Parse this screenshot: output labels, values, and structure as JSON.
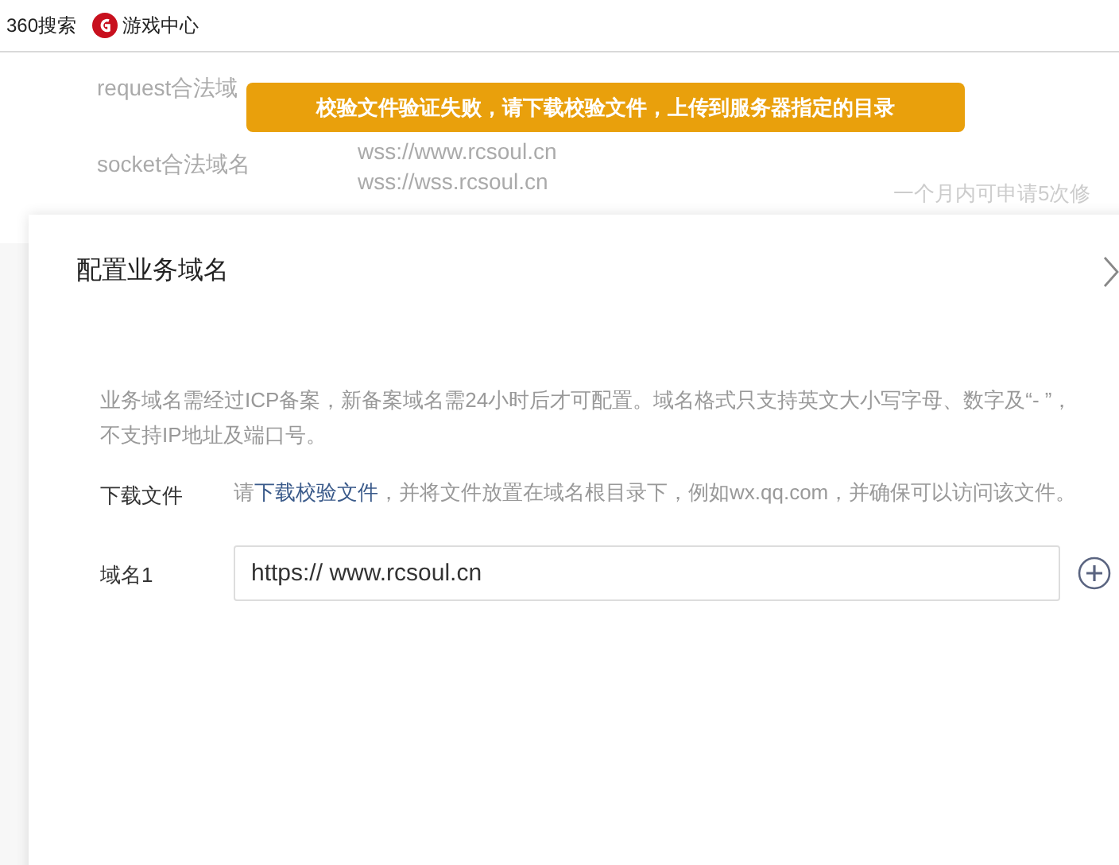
{
  "bookmarks": [
    {
      "label": "360搜索",
      "kind": "plain"
    },
    {
      "label": "游戏中心",
      "kind": "logo"
    }
  ],
  "background_page": {
    "rows": [
      {
        "label": "request合法域"
      },
      {
        "label": "socket合法域名",
        "values": [
          "wss://www.rcsoul.cn",
          "wss://wss.rcsoul.cn"
        ]
      }
    ],
    "hint": "一个月内可申请5次修"
  },
  "toast": {
    "message": "校验文件验证失败，请下载校验文件，上传到服务器指定的目录"
  },
  "dialog": {
    "title": "配置业务域名",
    "notice": "业务域名需经过ICP备案，新备案域名需24小时后才可配置。域名格式只支持英文大小写字母、数字及“- ”，不支持IP地址及端口号。",
    "download": {
      "label": "下载文件",
      "before": "请",
      "link": "下载校验文件",
      "after": "，并将文件放置在域名根目录下，例如wx.qq.com，并确保可以访问该文件。"
    },
    "domains": [
      {
        "label": "域名1",
        "value": "https:// www.rcsoul.cn"
      }
    ]
  }
}
